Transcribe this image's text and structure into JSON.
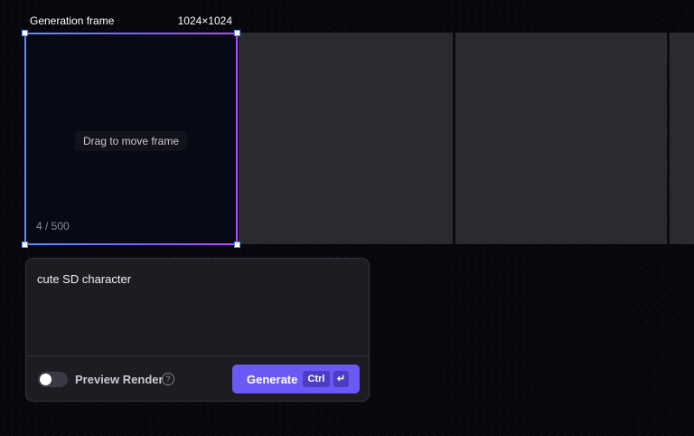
{
  "frame": {
    "title": "Generation frame",
    "size": "1024×1024",
    "drag_hint": "Drag to move frame",
    "char_count": "4 / 500",
    "gradient_colors": [
      "#5b8cff",
      "#7a63ff",
      "#b14cf5"
    ]
  },
  "prompt": {
    "text": "cute SD character",
    "preview_render_label": "Preview Render",
    "preview_render_enabled": false,
    "help_icon": "question-circle-icon",
    "generate_label": "Generate",
    "shortcut_ctrl": "Ctrl",
    "shortcut_enter_icon": "enter-key-icon",
    "shortcut_enter_glyph": "↵",
    "accent_color": "#6a59f4"
  },
  "canvas": {
    "background_color": "#07070d",
    "tile_color": "#2a2a31"
  }
}
